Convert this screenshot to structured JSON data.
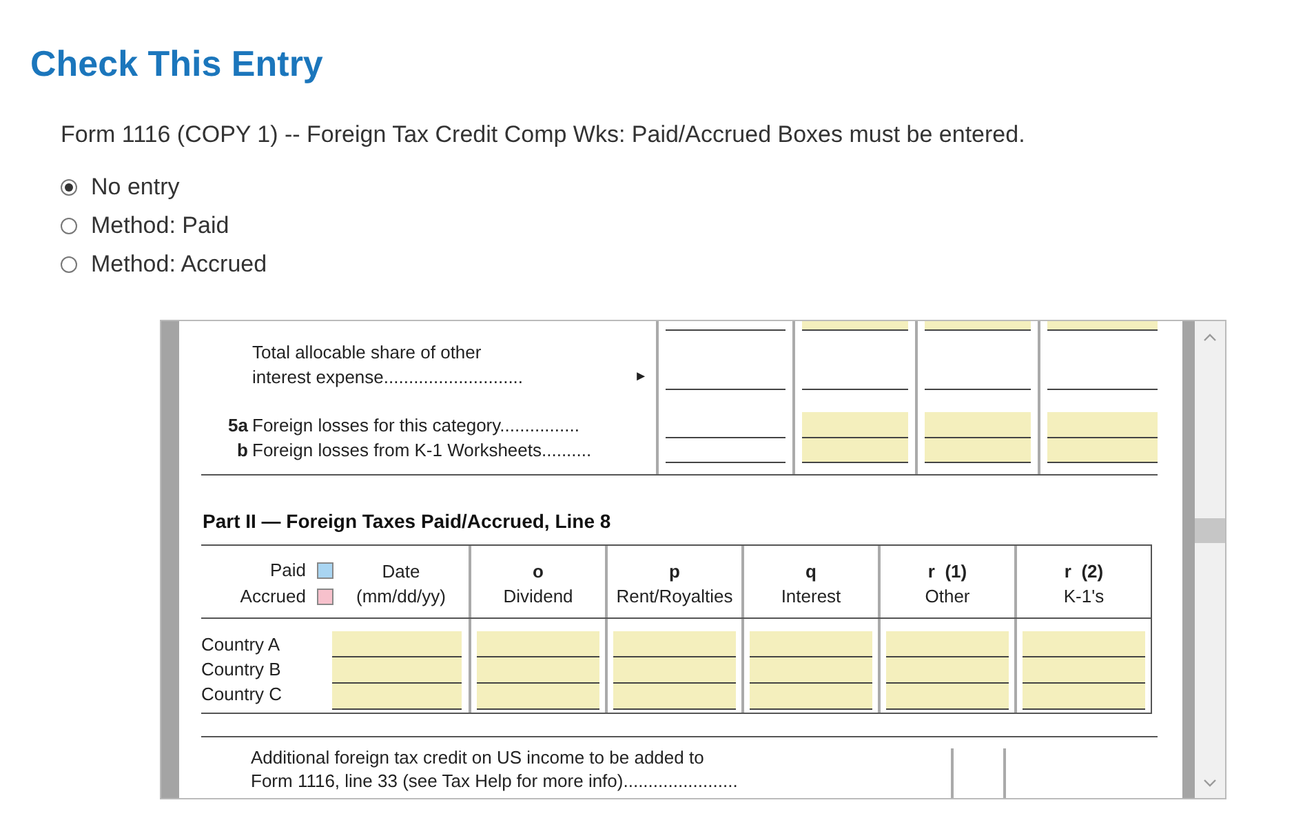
{
  "heading": "Check This Entry",
  "message": "Form 1116 (COPY 1) -- Foreign Tax Credit Comp Wks: Paid/Accrued Boxes must be entered.",
  "options": [
    {
      "label": "No entry",
      "selected": true
    },
    {
      "label": "Method: Paid",
      "selected": false
    },
    {
      "label": "Method: Accrued",
      "selected": false
    }
  ],
  "form": {
    "section_1": [
      {
        "fields": [
          {
            "highlighted": false
          },
          {
            "highlighted": true
          },
          {
            "highlighted": true
          },
          {
            "highlighted": true
          }
        ]
      },
      {
        "label_lines": [
          "Total allocable share of other",
          "interest expense............................"
        ],
        "arrow": "►",
        "fields": [
          {
            "highlighted": false
          },
          {
            "highlighted": false
          },
          {
            "highlighted": false
          },
          {
            "highlighted": false
          }
        ]
      },
      {
        "number": "5a",
        "label_lines": [
          "Foreign losses for this category................"
        ],
        "fields": [
          {
            "highlighted": false
          },
          {
            "highlighted": true
          },
          {
            "highlighted": true
          },
          {
            "highlighted": true
          }
        ]
      },
      {
        "number": "b",
        "label_lines": [
          "Foreign losses from K-1 Worksheets.........."
        ],
        "fields": [
          {
            "highlighted": false
          },
          {
            "highlighted": true
          },
          {
            "highlighted": true
          },
          {
            "highlighted": true
          }
        ]
      }
    ],
    "part_2": {
      "title": "Part II — Foreign Taxes Paid/Accrued, Line 8",
      "legend": [
        {
          "label": "Paid",
          "color": "#a9d5f2"
        },
        {
          "label": "Accrued",
          "color": "#f7c1cc"
        }
      ],
      "date_header": [
        "Date",
        "(mm/dd/yy)"
      ],
      "columns": [
        {
          "letter": "o",
          "name": "Dividend"
        },
        {
          "letter": "p",
          "name": "Rent/Royalties"
        },
        {
          "letter": "q",
          "name": "Interest"
        },
        {
          "letter": "r  (1)",
          "name": "Other"
        },
        {
          "letter": "r  (2)",
          "name": "K-1's"
        }
      ],
      "countries": [
        "Country A",
        "Country B",
        "Country C"
      ]
    },
    "footer_lines": [
      "Additional foreign tax credit on US income to be added to",
      "Form 1116, line 33 (see Tax Help for more info)......................."
    ]
  }
}
